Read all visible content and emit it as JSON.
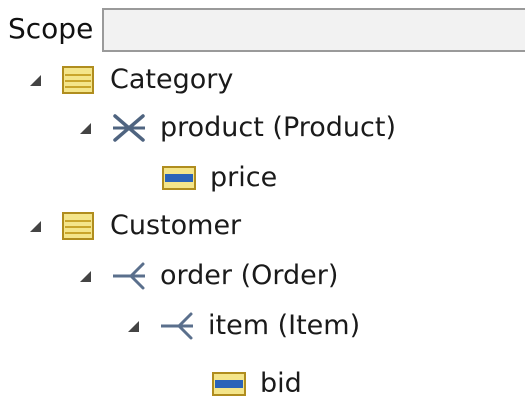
{
  "scope": {
    "label": "Scope",
    "value": ""
  },
  "tree": [
    {
      "label": "Category",
      "icon": "entity-icon",
      "expanded": true,
      "level": 0
    },
    {
      "label": "product (Product)",
      "icon": "many-to-many-relation-icon",
      "expanded": true,
      "level": 1
    },
    {
      "label": "price",
      "icon": "attribute-icon",
      "expanded": false,
      "level": 2
    },
    {
      "label": "Customer",
      "icon": "entity-icon",
      "expanded": true,
      "level": 0
    },
    {
      "label": "order (Order)",
      "icon": "one-to-many-relation-icon",
      "expanded": true,
      "level": 1
    },
    {
      "label": "item (Item)",
      "icon": "one-to-many-relation-icon",
      "expanded": true,
      "level": 2
    },
    {
      "label": "bid",
      "icon": "attribute-icon",
      "expanded": false,
      "level": 3
    }
  ],
  "colors": {
    "entity_fill": "#f4e58a",
    "entity_stroke": "#b08d1e",
    "attribute_bar": "#2b63b8",
    "relation_stroke": "#5a6f8c",
    "toggle": "#444444"
  }
}
